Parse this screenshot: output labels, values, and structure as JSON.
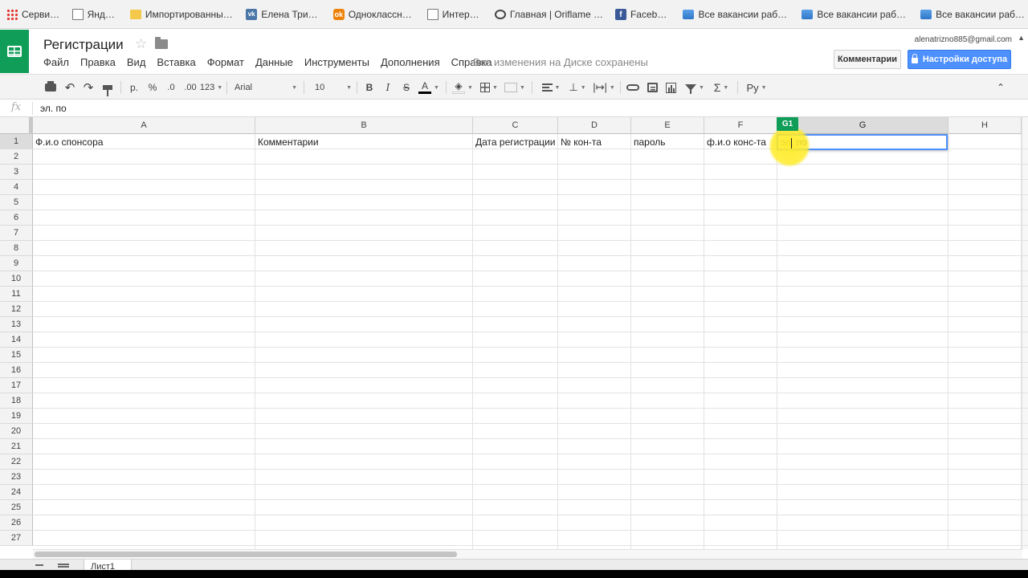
{
  "bookmarks": [
    {
      "label": "Сервисы",
      "icon": "apps-icon"
    },
    {
      "label": "Яндекс",
      "icon": "page-icon"
    },
    {
      "label": "Импортированные и",
      "icon": "folder-icon"
    },
    {
      "label": "Елена Тризно",
      "icon": "vk-icon"
    },
    {
      "label": "Одноклассники",
      "icon": "ok-icon"
    },
    {
      "label": "Интернет",
      "icon": "page-icon"
    },
    {
      "label": "Главная | Oriflame Co",
      "icon": "ring-icon"
    },
    {
      "label": "Facebook",
      "icon": "facebook-icon"
    },
    {
      "label": "Все вакансии работо",
      "icon": "blue-folder-icon"
    },
    {
      "label": "Все вакансии работо",
      "icon": "blue-folder-icon"
    },
    {
      "label": "Все вакансии работо",
      "icon": "blue-folder-icon"
    }
  ],
  "doc": {
    "title": "Регистрации",
    "save_status": "Все изменения на Диске сохранены",
    "user_email": "alenatrizno885@gmail.com"
  },
  "menu": [
    "Файл",
    "Правка",
    "Вид",
    "Вставка",
    "Формат",
    "Данные",
    "Инструменты",
    "Дополнения",
    "Справка"
  ],
  "buttons": {
    "comments": "Комментарии",
    "share": "Настройки доступа"
  },
  "toolbar": {
    "currency": "р.",
    "percent": "%",
    "decrease_decimals": ".0",
    "increase_decimals": ".00",
    "more_formats": "123",
    "font": "Arial",
    "font_size": "10",
    "bold": "B",
    "italic": "I",
    "strike": "S",
    "text_color": "A",
    "sum": "Σ",
    "input_tools": "Ру"
  },
  "formula": {
    "fx": "fx",
    "value": "эл. по"
  },
  "columns": [
    "A",
    "B",
    "C",
    "D",
    "E",
    "F",
    "G",
    "H"
  ],
  "rows": [
    "1",
    "2",
    "3",
    "4",
    "5",
    "6",
    "7",
    "8",
    "9",
    "10",
    "11",
    "12",
    "13",
    "14",
    "15",
    "16",
    "17",
    "18",
    "19",
    "20",
    "21",
    "22",
    "23",
    "24",
    "25",
    "26",
    "27"
  ],
  "row1": [
    "Ф.и.о спонсора",
    "Комментарии",
    "Дата регистрации",
    "№ кон-та",
    "пароль",
    "ф.и.о конс-та"
  ],
  "active_cell": {
    "ref": "G1",
    "value": "эл. по"
  },
  "sheet_tab": "Лист1",
  "colors": {
    "sheets_green": "#0f9d58",
    "share_blue": "#4d90fe",
    "cursor_yellow": "#ffeb28"
  }
}
